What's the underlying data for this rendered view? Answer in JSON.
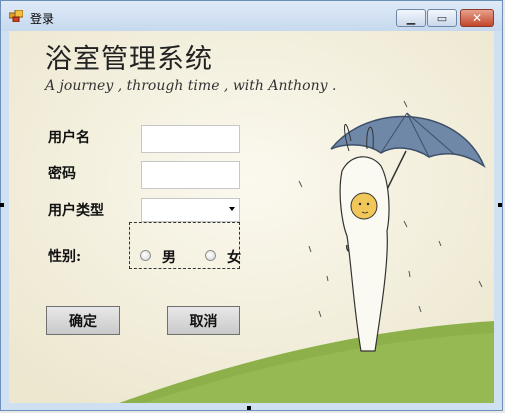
{
  "window": {
    "title": "登录",
    "icons": {
      "app": "app-window-icon",
      "minimize": "minimize-icon",
      "maximize": "maximize-icon",
      "close": "close-icon"
    }
  },
  "header": {
    "title": "浴室管理系统",
    "tagline": "A journey , through time , with Anthony ."
  },
  "form": {
    "username_label": "用户名",
    "username_value": "",
    "password_label": "密码",
    "password_value": "",
    "user_type_label": "用户类型",
    "user_type_value": "",
    "gender_label": "性别:",
    "gender_options": [
      "男",
      "女"
    ],
    "gender_selected": ""
  },
  "buttons": {
    "ok": "确定",
    "cancel": "取消"
  },
  "colors": {
    "umbrella": "#6f88a8",
    "grass": "#8db04a",
    "background": "#f6f3e5"
  }
}
